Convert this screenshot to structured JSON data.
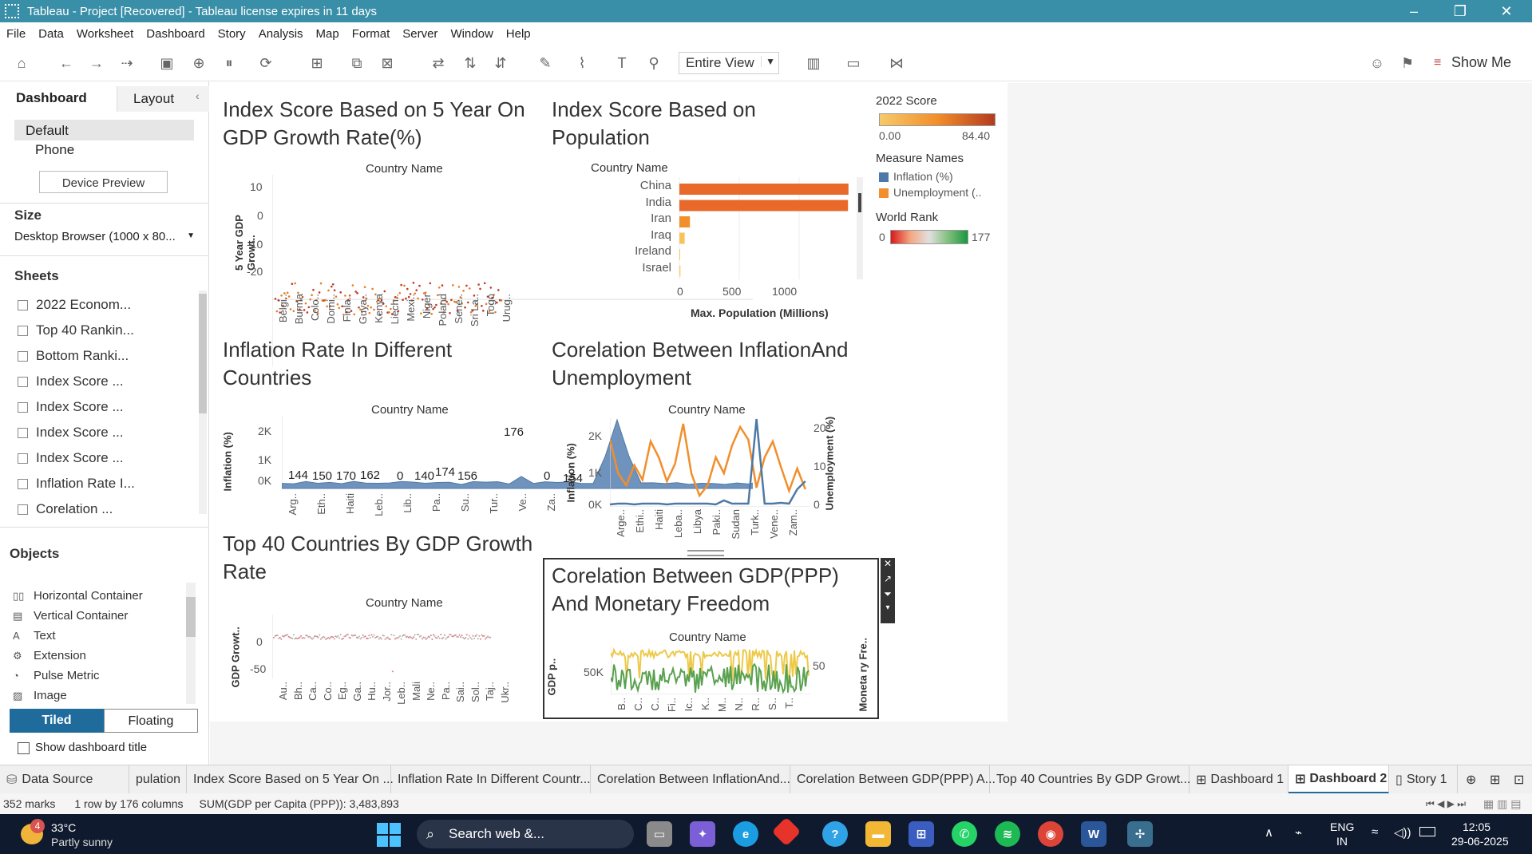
{
  "window": {
    "title": "Tableau - Project [Recovered] - Tableau license expires in 11 days"
  },
  "menu": [
    "File",
    "Data",
    "Worksheet",
    "Dashboard",
    "Story",
    "Analysis",
    "Map",
    "Format",
    "Server",
    "Window",
    "Help"
  ],
  "toolbar": {
    "view_select": "Entire View",
    "show_me": "Show Me"
  },
  "left_panel": {
    "tab_dashboard": "Dashboard",
    "tab_layout": "Layout",
    "device_default": "Default",
    "device_phone": "Phone",
    "device_preview": "Device Preview",
    "size_header": "Size",
    "size_value": "Desktop Browser (1000 x 80...",
    "sheets_header": "Sheets",
    "sheets": [
      "2022 Econom...",
      "Top 40 Rankin...",
      "Bottom Ranki...",
      "Index Score ...",
      "Index Score ...",
      "Index Score ...",
      "Index Score ...",
      "Inflation Rate I...",
      "Corelation ..."
    ],
    "objects_header": "Objects",
    "objects": [
      "Horizontal Container",
      "Vertical Container",
      "Text",
      "Extension",
      "Pulse Metric",
      "Image"
    ],
    "tiled": "Tiled",
    "floating": "Floating",
    "show_title": "Show dashboard title"
  },
  "legends": {
    "score_title": "2022 Score",
    "score_min": "0.00",
    "score_max": "84.40",
    "measure_title": "Measure Names",
    "measure_1": "Inflation (%)",
    "measure_2": "Unemployment (..",
    "rank_title": "World Rank",
    "rank_min": "0",
    "rank_max": "177",
    "colors": {
      "inflation": "#4e79a7",
      "unemployment": "#f28e2b",
      "gdp": "#edc948",
      "freedom": "#59a14f"
    }
  },
  "views": {
    "v1": {
      "title1": "Index Score Based on 5 Year On",
      "title2": "GDP Growth Rate(%)",
      "header": "Country Name",
      "ylabel": "5 Year GDP Growt..",
      "yticks": [
        "10",
        "0",
        "-10",
        "-20"
      ],
      "xticks": [
        "Belgi..",
        "Burma",
        "Colo..",
        "Domi..",
        "Finla..",
        "Guya..",
        "Kenya",
        "Liech..",
        "Mexi..",
        "Niger",
        "Poland",
        "Sene..",
        "Sri La..",
        "Togo",
        "Urug.."
      ]
    },
    "v2": {
      "title1": "Index Score Based on",
      "title2": "Population",
      "header": "Country Name",
      "xlabel": "Max. Population (Millions)",
      "xticks": [
        "0",
        "500",
        "1000"
      ],
      "countries": [
        "China",
        "India",
        "Iran",
        "Iraq",
        "Ireland",
        "Israel"
      ],
      "values": [
        1412,
        1408,
        88,
        44,
        5,
        9
      ]
    },
    "v3": {
      "title1": "Inflation Rate In Different",
      "title2": "Countries",
      "header": "Country Name",
      "ylabel": "Inflation (%)",
      "yticks": [
        "2K",
        "1K",
        "0K"
      ],
      "labels": [
        "144",
        "150",
        "170",
        "162",
        "0",
        "140",
        "174",
        "156",
        "176",
        "0",
        "154"
      ],
      "xticks": [
        "Arg..",
        "Eth..",
        "Haiti",
        "Leb..",
        "Lib..",
        "Pa..",
        "Su..",
        "Tur..",
        "Ve..",
        "Za.."
      ]
    },
    "v4": {
      "title1": "Corelation Between InflationAnd",
      "title2": "Unemployment",
      "header": "Country Name",
      "ylabel_left": "Inflation (%)",
      "ylabel_right": "Unemployment (%)",
      "yticks_left": [
        "2K",
        "1K",
        "0K"
      ],
      "yticks_right": [
        "20",
        "10",
        "0"
      ],
      "xticks": [
        "Arge..",
        "Ethi..",
        "Haiti",
        "Leba..",
        "Libya",
        "Paki..",
        "Sudan",
        "Turk..",
        "Vene..",
        "Zam.."
      ]
    },
    "v5": {
      "title1": "Top 40 Countries By GDP Growth",
      "title2": "Rate",
      "header": "Country Name",
      "ylabel": "GDP Growt..",
      "yticks": [
        "0",
        "-50"
      ],
      "xticks": [
        "Au..",
        "Bh..",
        "Ca..",
        "Co..",
        "Eg..",
        "Ga..",
        "Hu..",
        "Jor..",
        "Leb..",
        "Mali",
        "Ne..",
        "Pa..",
        "Sai..",
        "Sol..",
        "Taj..",
        "Ukr.."
      ]
    },
    "v6": {
      "title1": "Corelation Between GDP(PPP)",
      "title2": "And Monetary Freedom",
      "header": "Country Name",
      "ylabel_left": "GDP p..",
      "ylabel_right": "Moneta ry Fre..",
      "ytick_left": "50K",
      "ytick_right": "50",
      "xticks": [
        "B..",
        "C..",
        "C..",
        "Fi..",
        "Ic..",
        "K..",
        "M..",
        "N..",
        "R..",
        "S..",
        "T.."
      ]
    }
  },
  "tabs": [
    "Data Source",
    "pulation",
    "Index Score Based on 5 Year On ...",
    "Inflation Rate In Different Countr...",
    "Corelation Between InflationAnd...",
    "Corelation Between GDP(PPP) A...",
    "Top 40 Countries By GDP Growt...",
    "Dashboard 1",
    "Dashboard 2",
    "Story 1"
  ],
  "status": {
    "marks": "352 marks",
    "rows": "1 row by 176 columns",
    "sum": "SUM(GDP per Capita (PPP)): 3,483,893"
  },
  "taskbar": {
    "temp": "33°C",
    "weather": "Partly sunny",
    "search": "Search web &...",
    "lang1": "ENG",
    "lang2": "IN",
    "time": "12:05",
    "date": "29-06-2025",
    "badge": "4"
  }
}
